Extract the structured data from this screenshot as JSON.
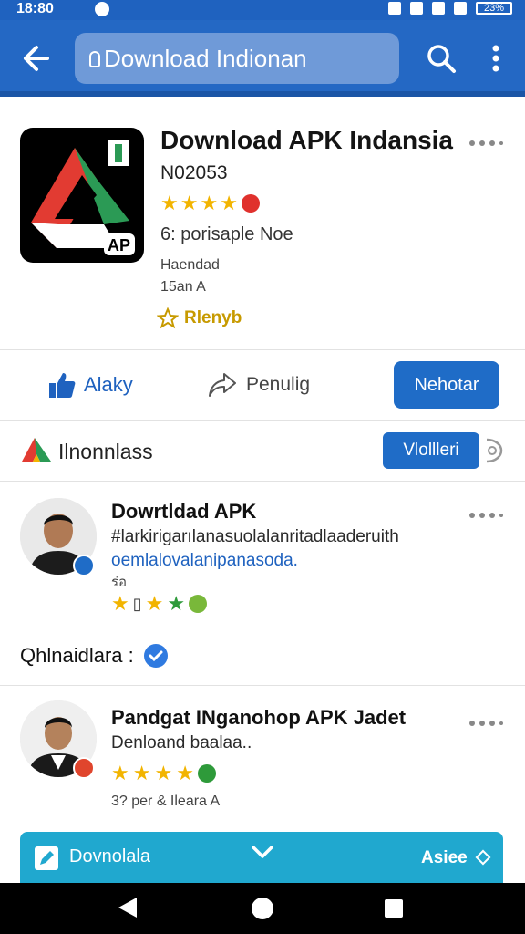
{
  "status_bar": {
    "time": "18:80",
    "battery": "23%"
  },
  "app_bar": {
    "search_text": "Download Indionan"
  },
  "app": {
    "title": "Download APK Indansia",
    "id": "N02053",
    "rating_stars": 4,
    "subtitle": "6: porisaple Noe",
    "meta1": "Haendad",
    "meta2": "15an A",
    "reply_label": "Rlenyb"
  },
  "actions": {
    "like_label": "Alaky",
    "share_label": "Penulig",
    "primary_label": "Nehotar"
  },
  "section": {
    "title": "Ilnonnlass",
    "view_button": "Vlollleri"
  },
  "reviews": [
    {
      "title": "Dowrtldad  APK",
      "line1": "#larkirigarılanasuolalanritadlaaderuith",
      "line2": "oemlalovalanipanasoda.",
      "small": "ร่อ"
    },
    {
      "title": "Pandgat INganohop APK Jadet",
      "line1": "Denloand baalaa..",
      "small": "3? per & Ileara A"
    }
  ],
  "verified_label": "Qhlnaidlara :",
  "banner": {
    "download_label": "Dovnolala",
    "next_label": "Asiee"
  },
  "colors": {
    "primary": "#2468c4",
    "accent": "#1f6cc7",
    "banner": "#20a8cf",
    "star": "#f2b400"
  }
}
